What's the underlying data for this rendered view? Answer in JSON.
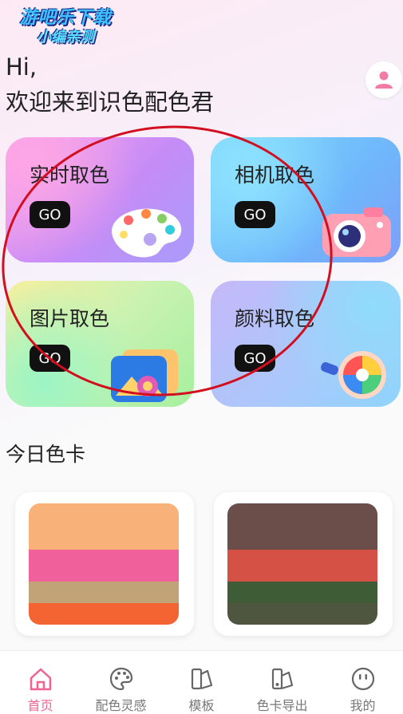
{
  "watermark": {
    "line1": "游吧乐下载",
    "line2": "小编亲测"
  },
  "greeting": {
    "hi": "Hi,",
    "welcome": "欢迎来到识色配色君"
  },
  "cards": [
    {
      "title": "实时取色",
      "button": "GO"
    },
    {
      "title": "相机取色",
      "button": "GO"
    },
    {
      "title": "图片取色",
      "button": "GO"
    },
    {
      "title": "颜料取色",
      "button": "GO"
    }
  ],
  "section": {
    "title": "今日色卡"
  },
  "palettes": [
    {
      "colors": [
        "#f9b17a",
        "#f0609a",
        "#c2a377",
        "#f46432"
      ]
    },
    {
      "colors": [
        "#6b4e4a",
        "#d55145",
        "#3e5c36",
        "#4f5640"
      ]
    }
  ],
  "tabs": [
    {
      "label": "首页",
      "icon": "home-icon",
      "active": true
    },
    {
      "label": "配色灵感",
      "icon": "palette-icon",
      "active": false
    },
    {
      "label": "模板",
      "icon": "template-icon",
      "active": false
    },
    {
      "label": "色卡导出",
      "icon": "color-card-export-icon",
      "active": false
    },
    {
      "label": "我的",
      "icon": "face-icon",
      "active": false
    }
  ],
  "colors": {
    "accent": "#f06292",
    "annotation": "#d20f1e"
  }
}
